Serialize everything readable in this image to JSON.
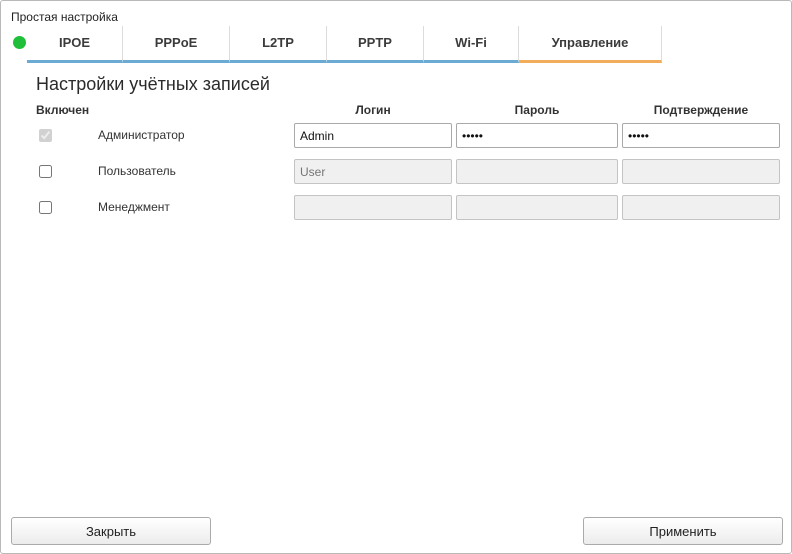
{
  "window": {
    "title": "Простая настройка"
  },
  "status": {
    "color": "#1fbf3a",
    "state": "connected"
  },
  "tabs": [
    {
      "label": "IPOE",
      "active": false
    },
    {
      "label": "PPPoE",
      "active": false
    },
    {
      "label": "L2TP",
      "active": false
    },
    {
      "label": "PPTP",
      "active": false
    },
    {
      "label": "Wi-Fi",
      "active": false
    },
    {
      "label": "Управление",
      "active": true
    }
  ],
  "section": {
    "title": "Настройки учётных записей"
  },
  "columns": {
    "enabled": "Включен",
    "login": "Логин",
    "password": "Пароль",
    "confirm": "Подтверждение"
  },
  "accounts": [
    {
      "label": "Администратор",
      "enabled": true,
      "checkbox_disabled": true,
      "login": "Admin",
      "login_placeholder": "",
      "password": "admin",
      "confirm": "admin",
      "fields_enabled": true
    },
    {
      "label": "Пользователь",
      "enabled": false,
      "checkbox_disabled": false,
      "login": "",
      "login_placeholder": "User",
      "password": "",
      "confirm": "",
      "fields_enabled": false
    },
    {
      "label": "Менеджмент",
      "enabled": false,
      "checkbox_disabled": false,
      "login": "",
      "login_placeholder": "",
      "password": "",
      "confirm": "",
      "fields_enabled": false
    }
  ],
  "buttons": {
    "close": "Закрыть",
    "apply": "Применить"
  },
  "colors": {
    "tab_underline": "#6aaad3",
    "tab_active_underline": "#f2ad5c"
  }
}
